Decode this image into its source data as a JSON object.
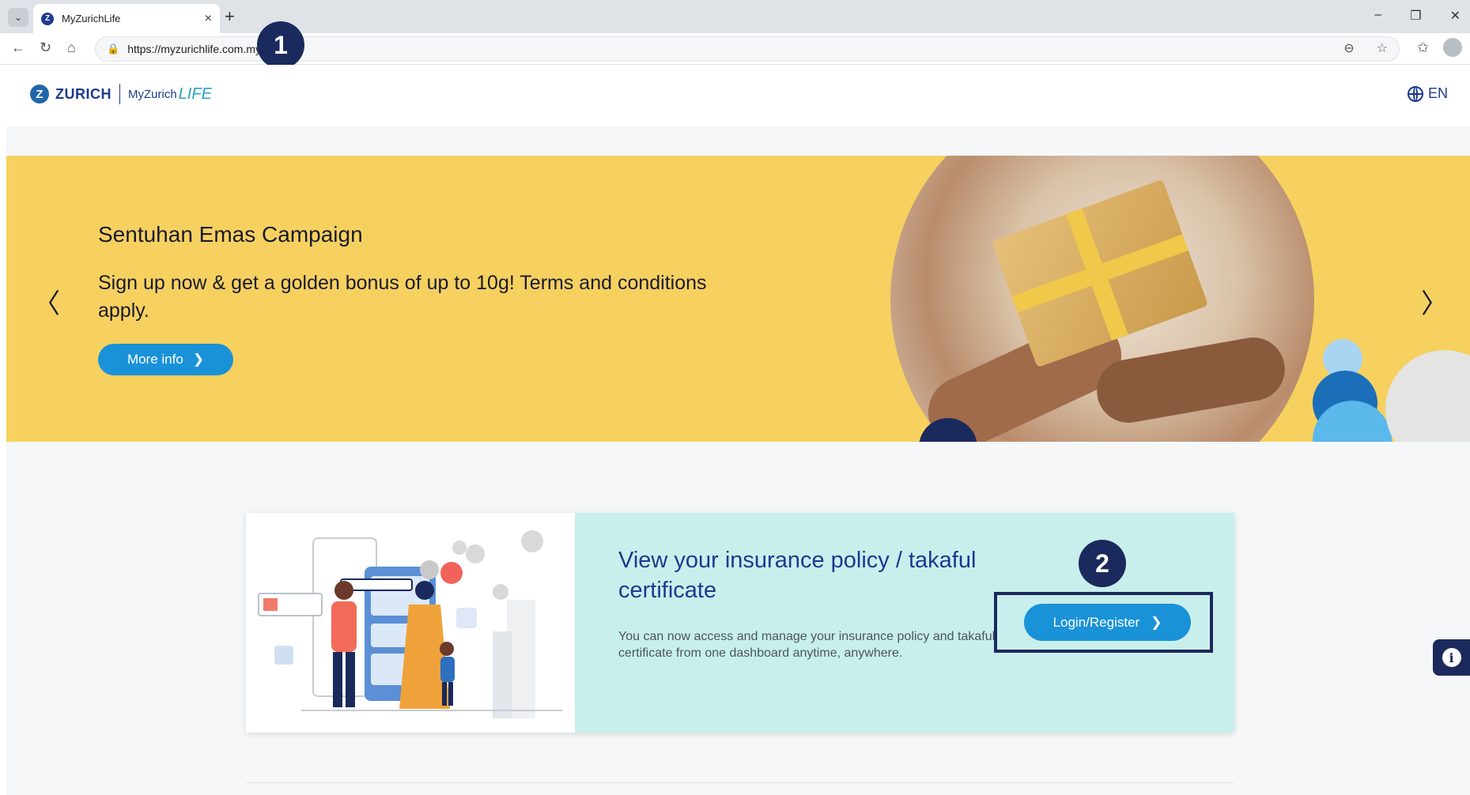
{
  "browser": {
    "tab_title": "MyZurichLife",
    "tab_close": "×",
    "new_tab": "+",
    "url": "https://myzurichlife.com.my",
    "window_controls": [
      "–",
      "❐",
      "✕"
    ]
  },
  "markers": {
    "first": "1",
    "second": "2"
  },
  "header": {
    "logo_z": "Z",
    "logo_word": "ZURICH",
    "logo_my": "MyZurich",
    "logo_life": "LIFE",
    "language": "EN"
  },
  "banner": {
    "title": "Sentuhan Emas Campaign",
    "subtitle": "Sign up now & get a golden bonus of up to 10g! Terms and conditions apply.",
    "button_label": "More info",
    "prev_arrow": "〈",
    "next_arrow": "〉"
  },
  "card": {
    "title": "View your insurance policy / takaful certificate",
    "description": "You can now access and manage your insurance policy and takaful certificate from one dashboard anytime, anywhere.",
    "button_label": "Login/Register"
  },
  "info_widget": {
    "icon_label": "i"
  },
  "colors": {
    "brand_navy": "#1b2a5c",
    "brand_blue": "#1a92d8",
    "banner_yellow": "#f6d15f",
    "card_teal": "#c9efec"
  }
}
